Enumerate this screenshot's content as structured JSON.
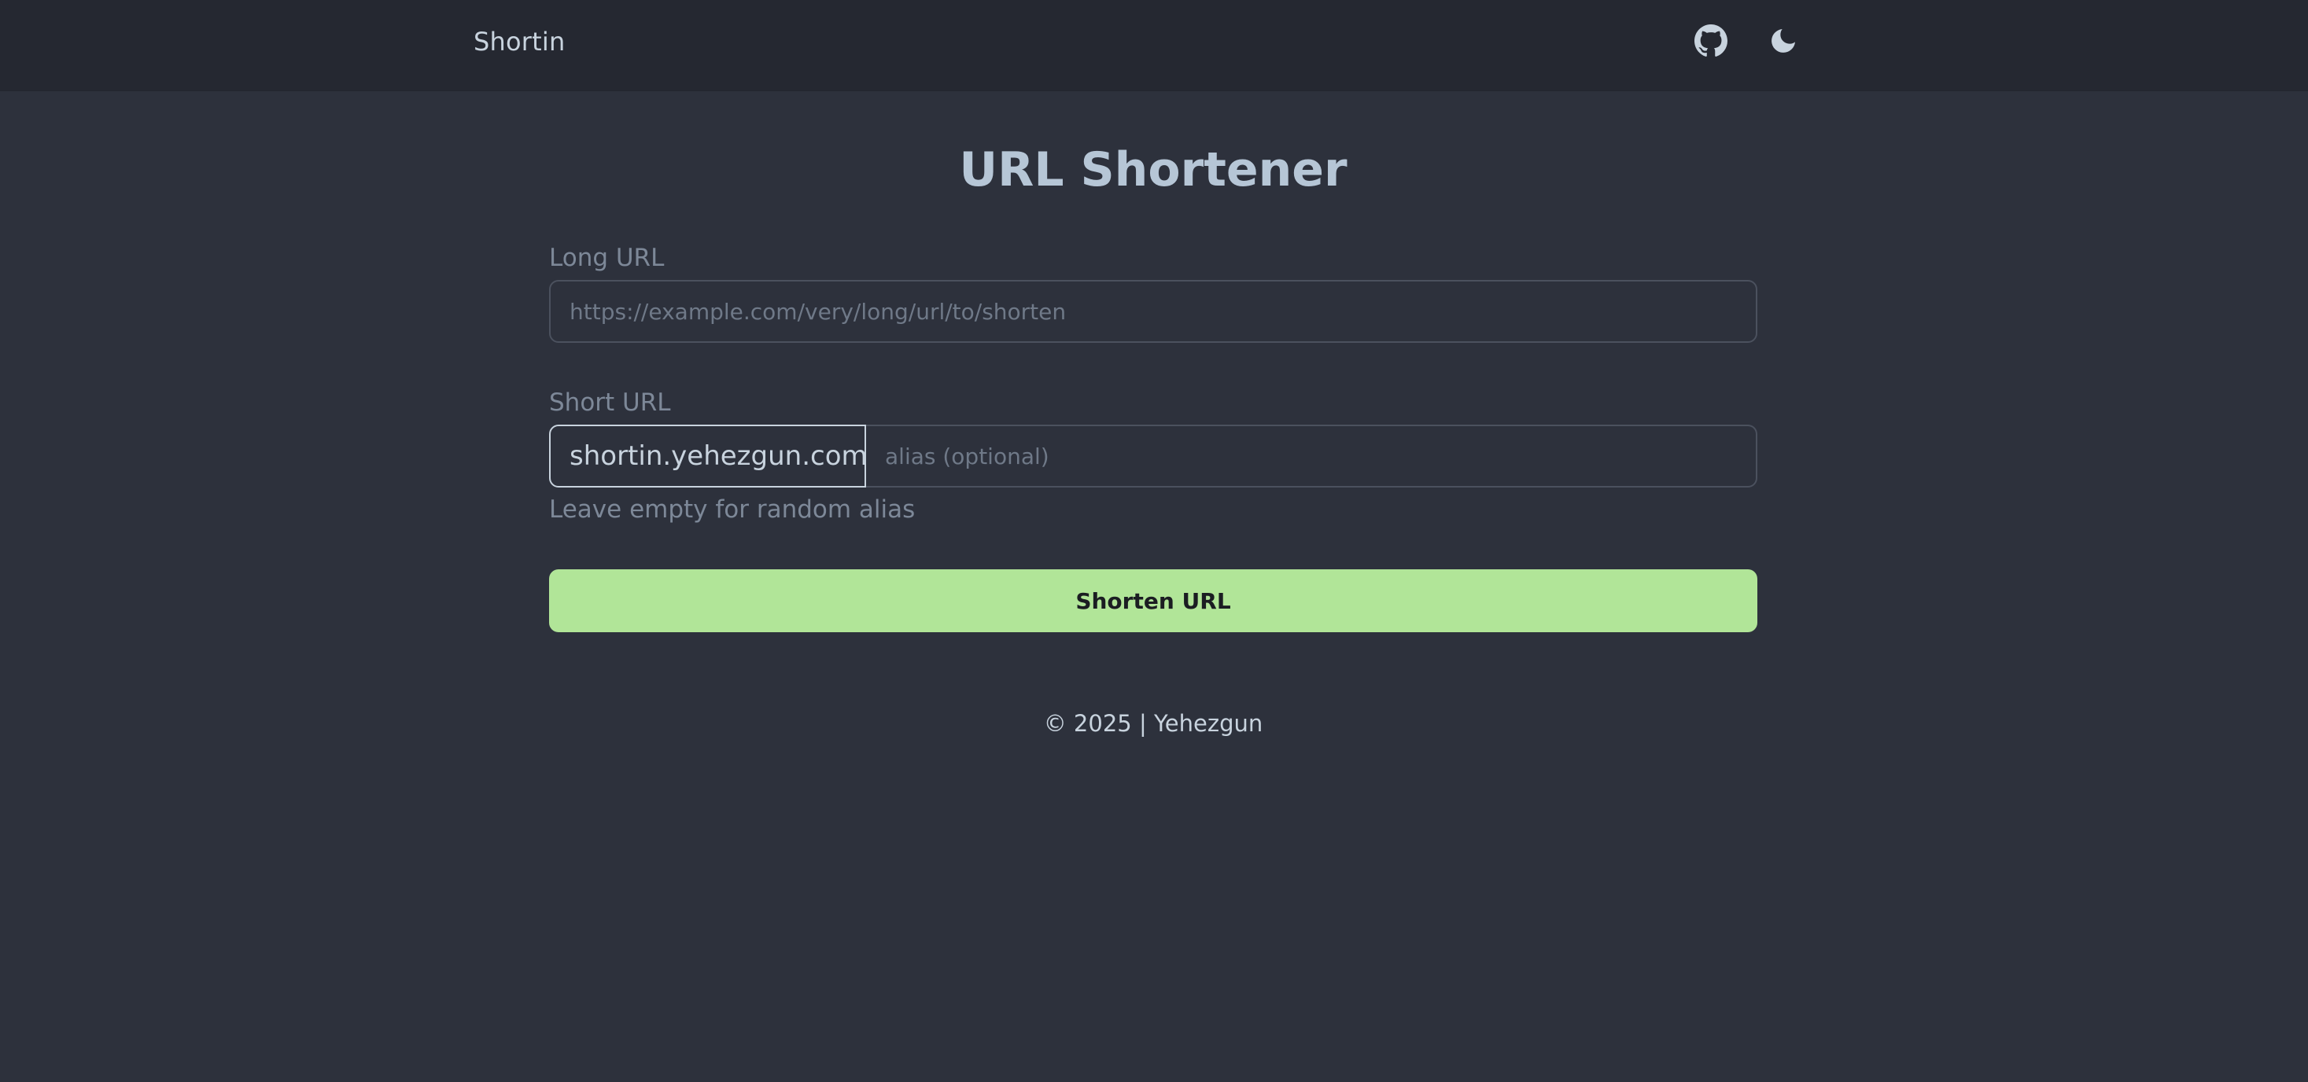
{
  "navbar": {
    "brand": "Shortin",
    "icons": [
      "github-icon",
      "moon-icon"
    ]
  },
  "main": {
    "title": "URL Shortener",
    "long_url": {
      "label": "Long URL",
      "value": "",
      "placeholder": "https://example.com/very/long/url/to/shorten"
    },
    "short_url": {
      "label": "Short URL",
      "prefix": "shortin.yehezgun.com/",
      "value": "",
      "placeholder": "alias (optional)",
      "helper": "Leave empty for random alias"
    },
    "submit_label": "Shorten URL"
  },
  "footer": {
    "text": "© 2025 | Yehezgun"
  },
  "colors": {
    "background": "#2d313c",
    "navbar": "#252831",
    "accent_button": "#b1e598",
    "title": "#b6c6d6",
    "muted_text": "#7d8898"
  }
}
